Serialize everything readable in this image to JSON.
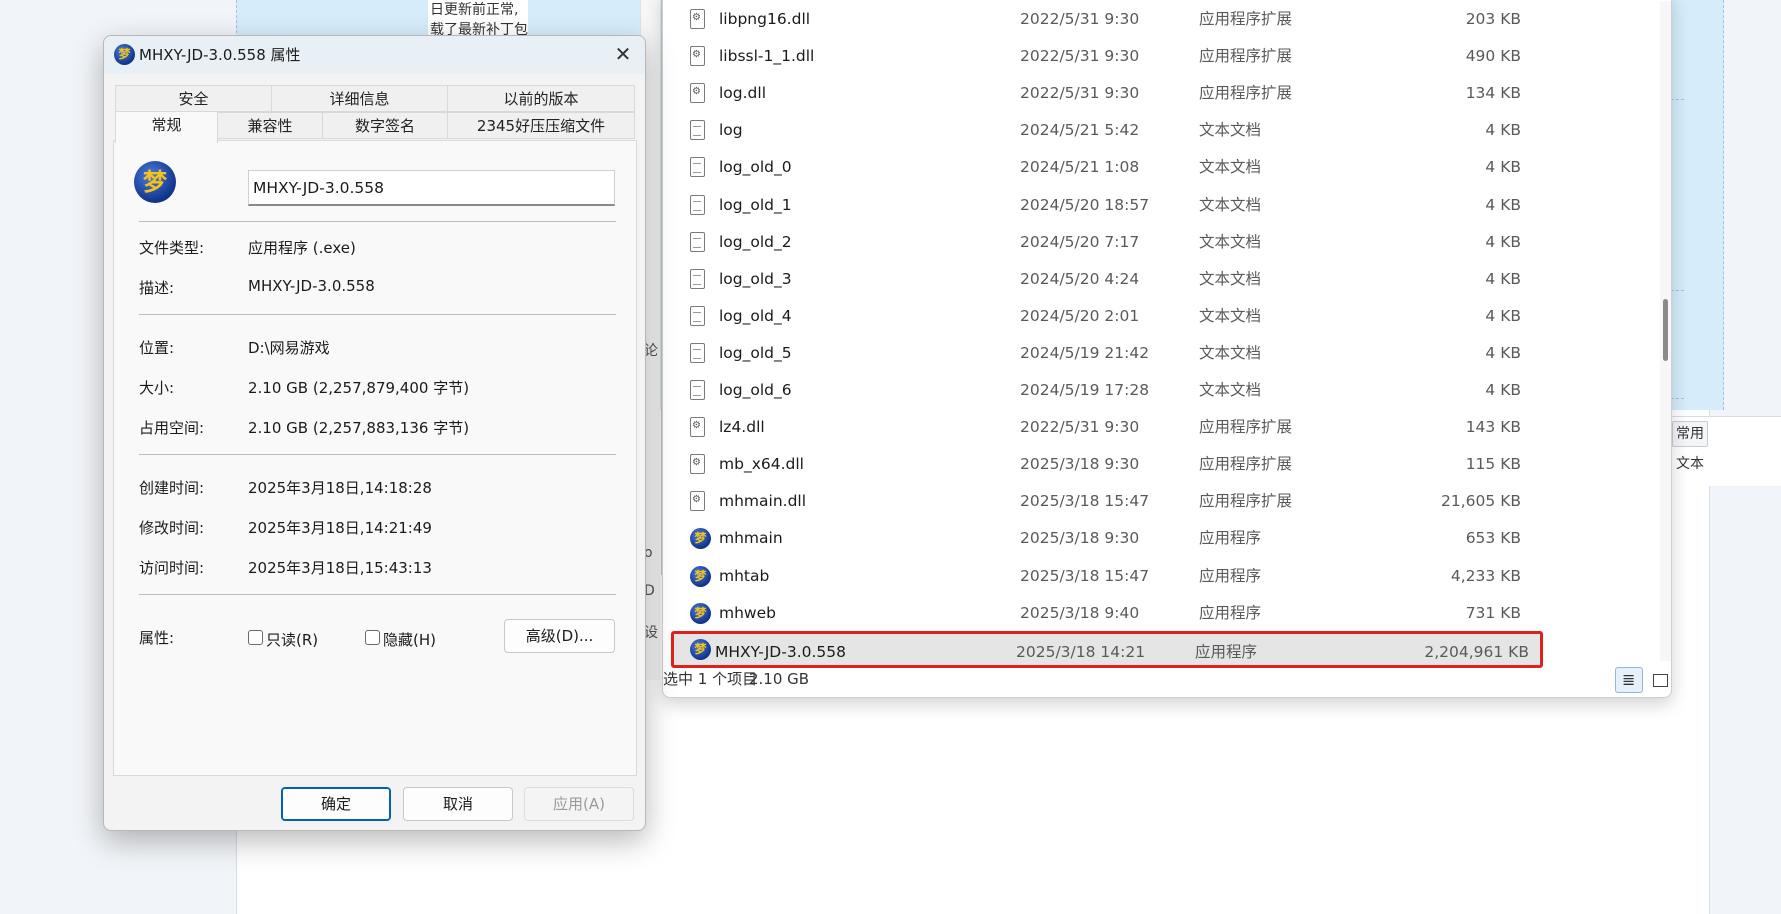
{
  "background": {
    "note_lines": [
      "日更新前正常,",
      "载了最新补丁包"
    ],
    "toolbar_chip": "常用",
    "toolbar_text": "文本",
    "strip_glyphs": [
      "论",
      "o",
      "D",
      "设"
    ]
  },
  "explorer": {
    "files": [
      {
        "name": "libpng16.dll",
        "date": "2022/5/31 9:30",
        "type": "应用程序扩展",
        "size": "203 KB",
        "icon": "dll-file-icon"
      },
      {
        "name": "libssl-1_1.dll",
        "date": "2022/5/31 9:30",
        "type": "应用程序扩展",
        "size": "490 KB",
        "icon": "dll-file-icon"
      },
      {
        "name": "log.dll",
        "date": "2022/5/31 9:30",
        "type": "应用程序扩展",
        "size": "134 KB",
        "icon": "dll-file-icon"
      },
      {
        "name": "log",
        "date": "2024/5/21 5:42",
        "type": "文本文档",
        "size": "4 KB",
        "icon": "text-file-icon"
      },
      {
        "name": "log_old_0",
        "date": "2024/5/21 1:08",
        "type": "文本文档",
        "size": "4 KB",
        "icon": "text-file-icon"
      },
      {
        "name": "log_old_1",
        "date": "2024/5/20 18:57",
        "type": "文本文档",
        "size": "4 KB",
        "icon": "text-file-icon"
      },
      {
        "name": "log_old_2",
        "date": "2024/5/20 7:17",
        "type": "文本文档",
        "size": "4 KB",
        "icon": "text-file-icon"
      },
      {
        "name": "log_old_3",
        "date": "2024/5/20 4:24",
        "type": "文本文档",
        "size": "4 KB",
        "icon": "text-file-icon"
      },
      {
        "name": "log_old_4",
        "date": "2024/5/20 2:01",
        "type": "文本文档",
        "size": "4 KB",
        "icon": "text-file-icon"
      },
      {
        "name": "log_old_5",
        "date": "2024/5/19 21:42",
        "type": "文本文档",
        "size": "4 KB",
        "icon": "text-file-icon"
      },
      {
        "name": "log_old_6",
        "date": "2024/5/19 17:28",
        "type": "文本文档",
        "size": "4 KB",
        "icon": "text-file-icon"
      },
      {
        "name": "lz4.dll",
        "date": "2022/5/31 9:30",
        "type": "应用程序扩展",
        "size": "143 KB",
        "icon": "dll-file-icon"
      },
      {
        "name": "mb_x64.dll",
        "date": "2025/3/18 9:30",
        "type": "应用程序扩展",
        "size": "115 KB",
        "icon": "dll-file-icon"
      },
      {
        "name": "mhmain.dll",
        "date": "2025/3/18 15:47",
        "type": "应用程序扩展",
        "size": "21,605 KB",
        "icon": "dll-file-icon"
      },
      {
        "name": "mhmain",
        "date": "2025/3/18 9:30",
        "type": "应用程序",
        "size": "653 KB",
        "icon": "game-app-icon"
      },
      {
        "name": "mhtab",
        "date": "2025/3/18 15:47",
        "type": "应用程序",
        "size": "4,233 KB",
        "icon": "game-app-icon"
      },
      {
        "name": "mhweb",
        "date": "2025/3/18 9:40",
        "type": "应用程序",
        "size": "731 KB",
        "icon": "game-app-icon"
      },
      {
        "name": "MHXY-JD-3.0.558",
        "date": "2025/3/18 14:21",
        "type": "应用程序",
        "size": "2,204,961 KB",
        "icon": "game-app-icon",
        "selected": true
      }
    ],
    "status": {
      "selection": "选中 1 个项目",
      "size": "2.10 GB"
    }
  },
  "dialog": {
    "title": "MHXY-JD-3.0.558 属性",
    "app_glyph": "梦",
    "tabs_row1": [
      "安全",
      "详细信息",
      "以前的版本"
    ],
    "tabs_row2": [
      "常规",
      "兼容性",
      "数字签名",
      "2345好压压缩文件"
    ],
    "name_value": "MHXY-JD-3.0.558",
    "props": {
      "file_type": {
        "label": "文件类型:",
        "value": "应用程序 (.exe)"
      },
      "description": {
        "label": "描述:",
        "value": "MHXY-JD-3.0.558"
      },
      "location": {
        "label": "位置:",
        "value": "D:\\网易游戏"
      },
      "size": {
        "label": "大小:",
        "value": "2.10 GB (2,257,879,400 字节)"
      },
      "size_on_disk": {
        "label": "占用空间:",
        "value": "2.10 GB (2,257,883,136 字节)"
      },
      "created": {
        "label": "创建时间:",
        "value": "2025年3月18日,14:18:28"
      },
      "modified": {
        "label": "修改时间:",
        "value": "2025年3月18日,14:21:49"
      },
      "accessed": {
        "label": "访问时间:",
        "value": "2025年3月18日,15:43:13"
      }
    },
    "attributes": {
      "label": "属性:",
      "readonly": "只读(R)",
      "hidden": "隐藏(H)",
      "advanced": "高级(D)..."
    },
    "buttons": {
      "ok": "确定",
      "cancel": "取消",
      "apply": "应用(A)"
    }
  },
  "colors": {
    "selection_outline": "#e0201c",
    "accent": "#005fb8",
    "background_blue": "#d6ecfa"
  }
}
